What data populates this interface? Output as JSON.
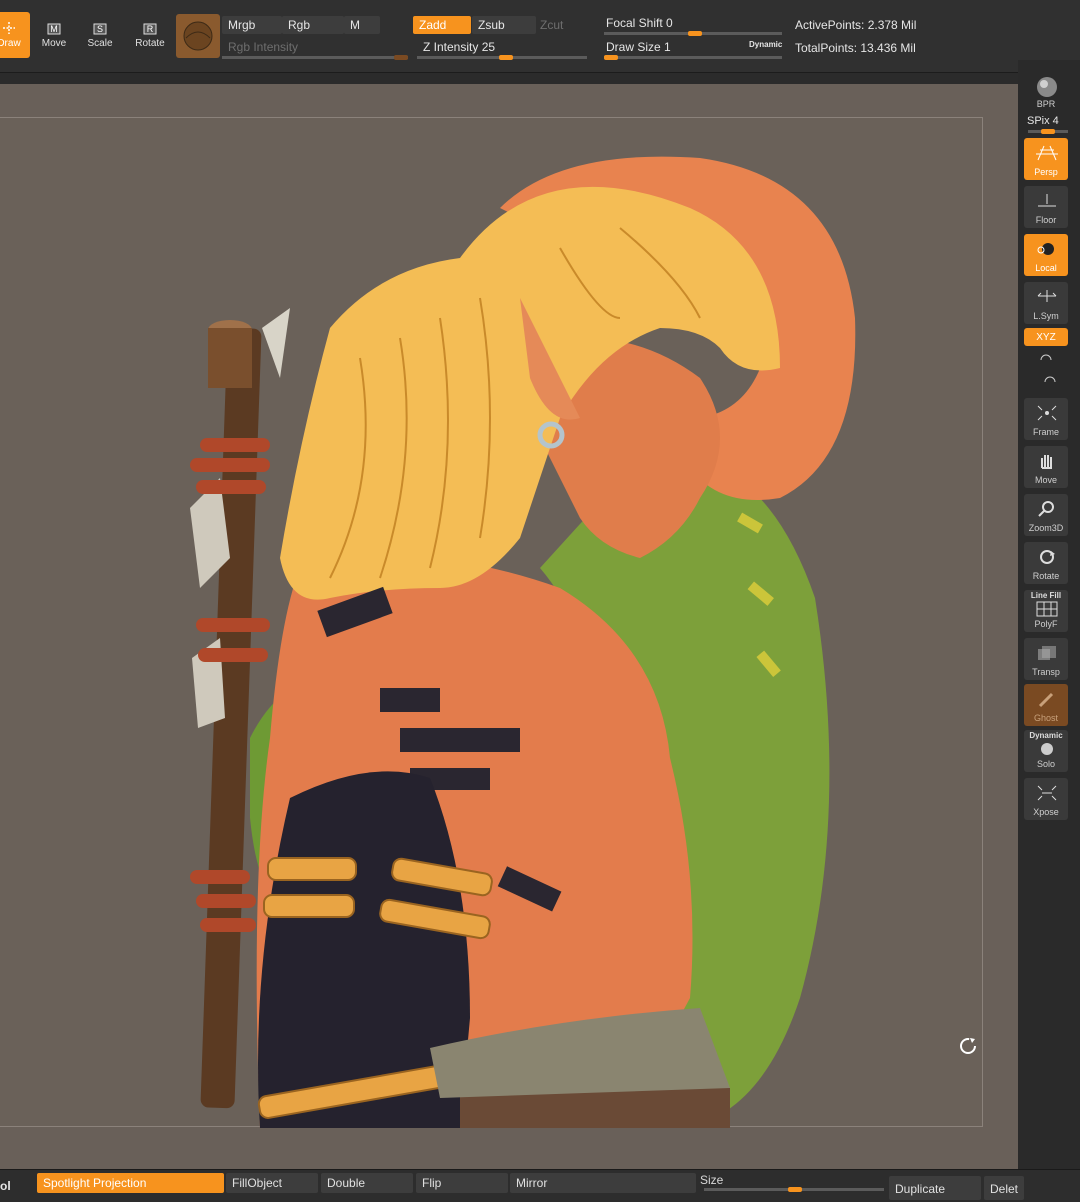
{
  "toolbar": {
    "tools": [
      {
        "key": "",
        "label": "Draw",
        "active": true
      },
      {
        "key": "M",
        "label": "Move",
        "active": false
      },
      {
        "key": "S",
        "label": "Scale",
        "active": false
      },
      {
        "key": "R",
        "label": "Rotate",
        "active": false
      }
    ],
    "mrgb": "Mrgb",
    "rgb": "Rgb",
    "m": "M",
    "rgb_intensity": "Rgb Intensity",
    "zadd": "Zadd",
    "zsub": "Zsub",
    "zcut": "Zcut",
    "z_intensity_label": "Z Intensity",
    "z_intensity_value": "25",
    "focal_shift_label": "Focal Shift",
    "focal_shift_value": "0",
    "draw_size_label": "Draw Size",
    "draw_size_value": "1",
    "dynamic": "Dynamic",
    "active_points": "ActivePoints: 2.378 Mil",
    "total_points": "TotalPoints: 13.436 Mil"
  },
  "shelf": {
    "bpr": "BPR",
    "spix": "SPix 4",
    "persp": "Persp",
    "floor": "Floor",
    "local": "Local",
    "lsym": "L.Sym",
    "xyz": "XYZ",
    "frame": "Frame",
    "move": "Move",
    "zoom3d": "Zoom3D",
    "rotate": "Rotate",
    "line_fill": "Line Fill",
    "polyf": "PolyF",
    "transp": "Transp",
    "ghost": "Ghost",
    "dynamic": "Dynamic",
    "solo": "Solo",
    "xpose": "Xpose"
  },
  "bottombar": {
    "ol": "ol",
    "spotlight": "Spotlight Projection",
    "fillobject": "FillObject",
    "double": "Double",
    "flip": "Flip",
    "mirror": "Mirror",
    "size": "Size",
    "duplicate": "Duplicate",
    "delete": "Delet"
  },
  "colors": {
    "accent": "#f7931e",
    "viewport": "#696059",
    "panel": "#303030"
  }
}
